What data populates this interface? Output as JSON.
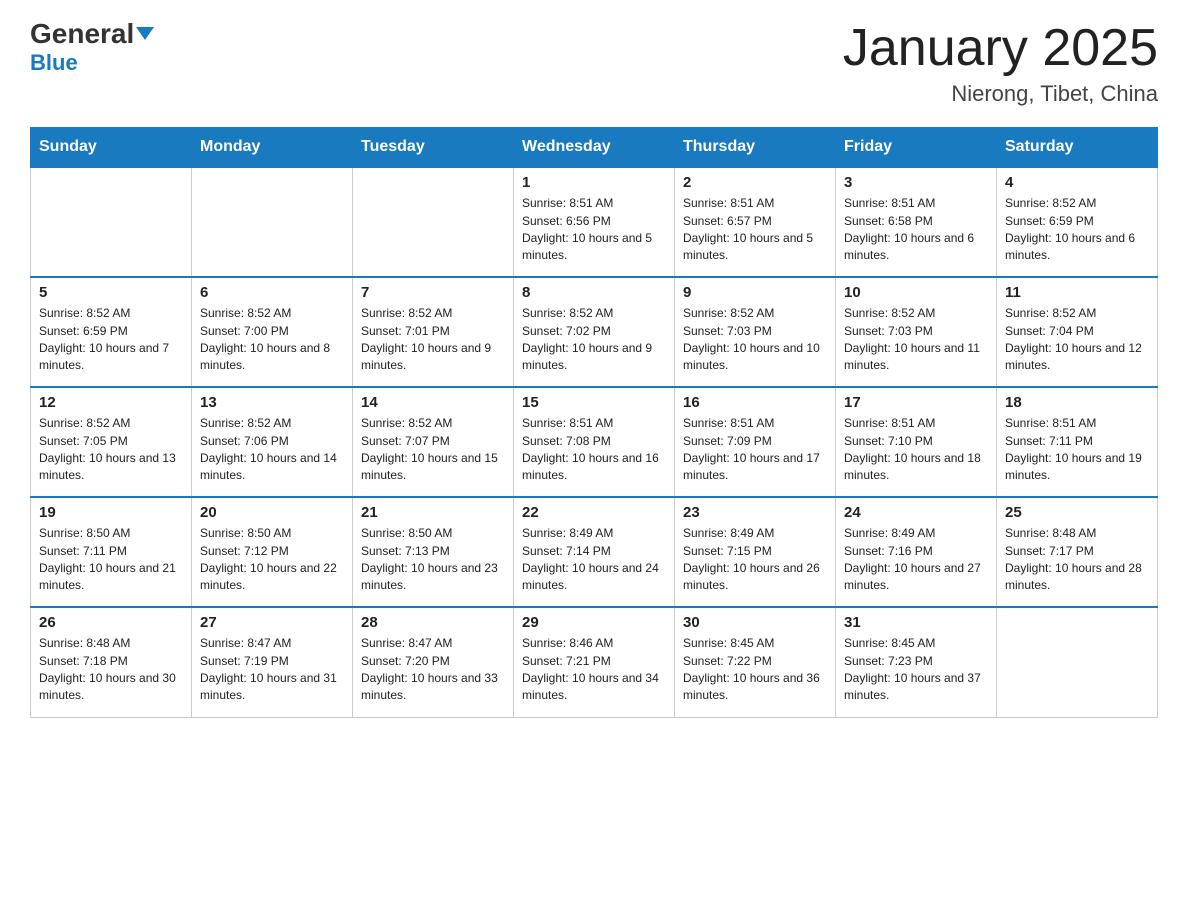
{
  "header": {
    "logo_general": "General",
    "logo_blue": "Blue",
    "month_title": "January 2025",
    "location": "Nierong, Tibet, China"
  },
  "weekdays": [
    "Sunday",
    "Monday",
    "Tuesday",
    "Wednesday",
    "Thursday",
    "Friday",
    "Saturday"
  ],
  "weeks": [
    [
      {
        "day": "",
        "sunrise": "",
        "sunset": "",
        "daylight": ""
      },
      {
        "day": "",
        "sunrise": "",
        "sunset": "",
        "daylight": ""
      },
      {
        "day": "",
        "sunrise": "",
        "sunset": "",
        "daylight": ""
      },
      {
        "day": "1",
        "sunrise": "Sunrise: 8:51 AM",
        "sunset": "Sunset: 6:56 PM",
        "daylight": "Daylight: 10 hours and 5 minutes."
      },
      {
        "day": "2",
        "sunrise": "Sunrise: 8:51 AM",
        "sunset": "Sunset: 6:57 PM",
        "daylight": "Daylight: 10 hours and 5 minutes."
      },
      {
        "day": "3",
        "sunrise": "Sunrise: 8:51 AM",
        "sunset": "Sunset: 6:58 PM",
        "daylight": "Daylight: 10 hours and 6 minutes."
      },
      {
        "day": "4",
        "sunrise": "Sunrise: 8:52 AM",
        "sunset": "Sunset: 6:59 PM",
        "daylight": "Daylight: 10 hours and 6 minutes."
      }
    ],
    [
      {
        "day": "5",
        "sunrise": "Sunrise: 8:52 AM",
        "sunset": "Sunset: 6:59 PM",
        "daylight": "Daylight: 10 hours and 7 minutes."
      },
      {
        "day": "6",
        "sunrise": "Sunrise: 8:52 AM",
        "sunset": "Sunset: 7:00 PM",
        "daylight": "Daylight: 10 hours and 8 minutes."
      },
      {
        "day": "7",
        "sunrise": "Sunrise: 8:52 AM",
        "sunset": "Sunset: 7:01 PM",
        "daylight": "Daylight: 10 hours and 9 minutes."
      },
      {
        "day": "8",
        "sunrise": "Sunrise: 8:52 AM",
        "sunset": "Sunset: 7:02 PM",
        "daylight": "Daylight: 10 hours and 9 minutes."
      },
      {
        "day": "9",
        "sunrise": "Sunrise: 8:52 AM",
        "sunset": "Sunset: 7:03 PM",
        "daylight": "Daylight: 10 hours and 10 minutes."
      },
      {
        "day": "10",
        "sunrise": "Sunrise: 8:52 AM",
        "sunset": "Sunset: 7:03 PM",
        "daylight": "Daylight: 10 hours and 11 minutes."
      },
      {
        "day": "11",
        "sunrise": "Sunrise: 8:52 AM",
        "sunset": "Sunset: 7:04 PM",
        "daylight": "Daylight: 10 hours and 12 minutes."
      }
    ],
    [
      {
        "day": "12",
        "sunrise": "Sunrise: 8:52 AM",
        "sunset": "Sunset: 7:05 PM",
        "daylight": "Daylight: 10 hours and 13 minutes."
      },
      {
        "day": "13",
        "sunrise": "Sunrise: 8:52 AM",
        "sunset": "Sunset: 7:06 PM",
        "daylight": "Daylight: 10 hours and 14 minutes."
      },
      {
        "day": "14",
        "sunrise": "Sunrise: 8:52 AM",
        "sunset": "Sunset: 7:07 PM",
        "daylight": "Daylight: 10 hours and 15 minutes."
      },
      {
        "day": "15",
        "sunrise": "Sunrise: 8:51 AM",
        "sunset": "Sunset: 7:08 PM",
        "daylight": "Daylight: 10 hours and 16 minutes."
      },
      {
        "day": "16",
        "sunrise": "Sunrise: 8:51 AM",
        "sunset": "Sunset: 7:09 PM",
        "daylight": "Daylight: 10 hours and 17 minutes."
      },
      {
        "day": "17",
        "sunrise": "Sunrise: 8:51 AM",
        "sunset": "Sunset: 7:10 PM",
        "daylight": "Daylight: 10 hours and 18 minutes."
      },
      {
        "day": "18",
        "sunrise": "Sunrise: 8:51 AM",
        "sunset": "Sunset: 7:11 PM",
        "daylight": "Daylight: 10 hours and 19 minutes."
      }
    ],
    [
      {
        "day": "19",
        "sunrise": "Sunrise: 8:50 AM",
        "sunset": "Sunset: 7:11 PM",
        "daylight": "Daylight: 10 hours and 21 minutes."
      },
      {
        "day": "20",
        "sunrise": "Sunrise: 8:50 AM",
        "sunset": "Sunset: 7:12 PM",
        "daylight": "Daylight: 10 hours and 22 minutes."
      },
      {
        "day": "21",
        "sunrise": "Sunrise: 8:50 AM",
        "sunset": "Sunset: 7:13 PM",
        "daylight": "Daylight: 10 hours and 23 minutes."
      },
      {
        "day": "22",
        "sunrise": "Sunrise: 8:49 AM",
        "sunset": "Sunset: 7:14 PM",
        "daylight": "Daylight: 10 hours and 24 minutes."
      },
      {
        "day": "23",
        "sunrise": "Sunrise: 8:49 AM",
        "sunset": "Sunset: 7:15 PM",
        "daylight": "Daylight: 10 hours and 26 minutes."
      },
      {
        "day": "24",
        "sunrise": "Sunrise: 8:49 AM",
        "sunset": "Sunset: 7:16 PM",
        "daylight": "Daylight: 10 hours and 27 minutes."
      },
      {
        "day": "25",
        "sunrise": "Sunrise: 8:48 AM",
        "sunset": "Sunset: 7:17 PM",
        "daylight": "Daylight: 10 hours and 28 minutes."
      }
    ],
    [
      {
        "day": "26",
        "sunrise": "Sunrise: 8:48 AM",
        "sunset": "Sunset: 7:18 PM",
        "daylight": "Daylight: 10 hours and 30 minutes."
      },
      {
        "day": "27",
        "sunrise": "Sunrise: 8:47 AM",
        "sunset": "Sunset: 7:19 PM",
        "daylight": "Daylight: 10 hours and 31 minutes."
      },
      {
        "day": "28",
        "sunrise": "Sunrise: 8:47 AM",
        "sunset": "Sunset: 7:20 PM",
        "daylight": "Daylight: 10 hours and 33 minutes."
      },
      {
        "day": "29",
        "sunrise": "Sunrise: 8:46 AM",
        "sunset": "Sunset: 7:21 PM",
        "daylight": "Daylight: 10 hours and 34 minutes."
      },
      {
        "day": "30",
        "sunrise": "Sunrise: 8:45 AM",
        "sunset": "Sunset: 7:22 PM",
        "daylight": "Daylight: 10 hours and 36 minutes."
      },
      {
        "day": "31",
        "sunrise": "Sunrise: 8:45 AM",
        "sunset": "Sunset: 7:23 PM",
        "daylight": "Daylight: 10 hours and 37 minutes."
      },
      {
        "day": "",
        "sunrise": "",
        "sunset": "",
        "daylight": ""
      }
    ]
  ]
}
